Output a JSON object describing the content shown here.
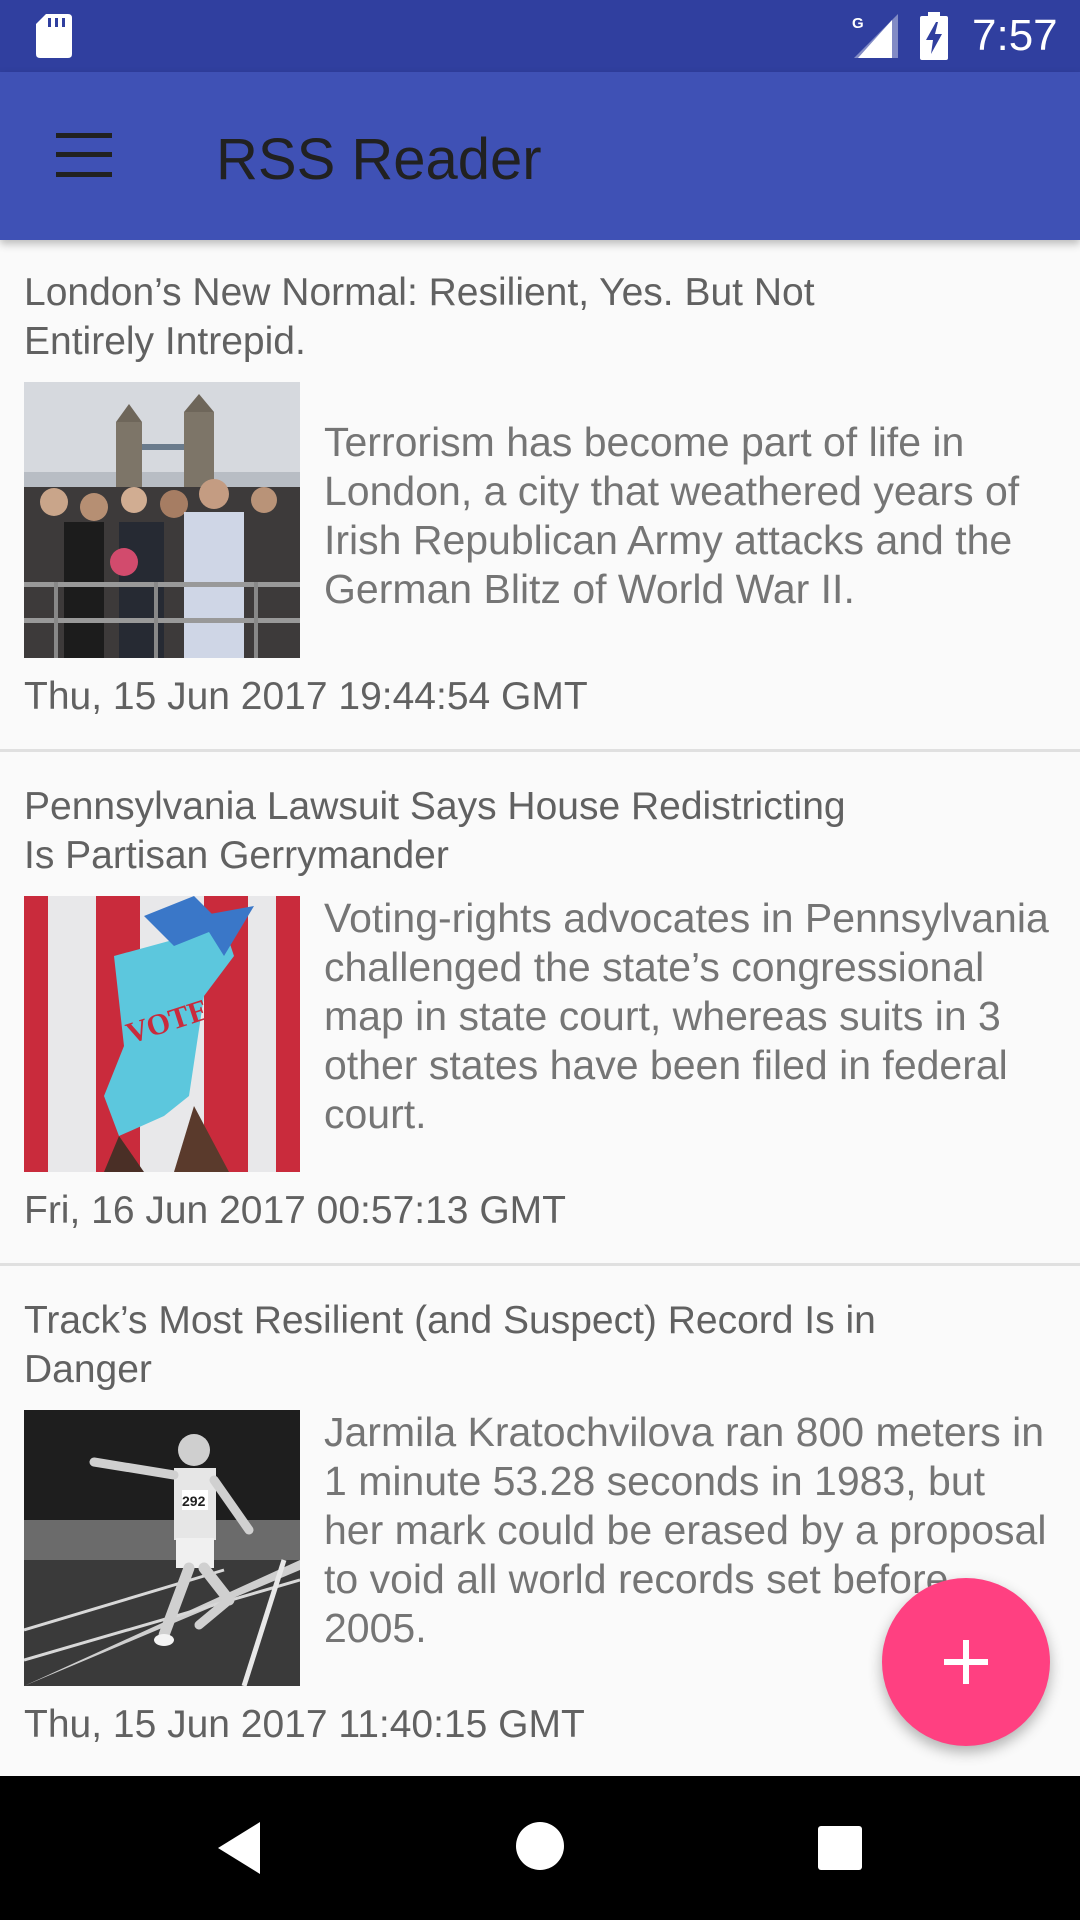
{
  "status_bar": {
    "time": "7:57",
    "network": "G",
    "icons": [
      "sd-card-icon",
      "signal-icon",
      "battery-charging-icon"
    ]
  },
  "app_bar": {
    "title": "RSS Reader",
    "menu_icon": "hamburger-menu-icon"
  },
  "articles": [
    {
      "title": "London’s New Normal: Resilient, Yes. But Not Entirely Intrepid.",
      "description": "Terrorism has become part of life in London, a city that weathered years of Irish Republican Army attacks and the German Blitz of World War II.",
      "date": "Thu, 15 Jun 2017 19:44:54 GMT"
    },
    {
      "title": "Pennsylvania Lawsuit Says House Redistricting Is Partisan Gerrymander",
      "description": "Voting-rights advocates in Pennsylvania challenged the state’s congressional map in state court, whereas suits in 3 other states have been filed in federal court.",
      "date": "Fri, 16 Jun 2017 00:57:13 GMT"
    },
    {
      "title": "Track’s Most Resilient (and Suspect) Record Is in Danger",
      "description": "Jarmila Kratochvilova ran 800 meters in 1 minute 53.28 seconds in 1983, but her mark could be erased by a proposal to void all world records set before 2005.",
      "date": "Thu, 15 Jun 2017 11:40:15 GMT"
    }
  ],
  "fab": {
    "icon": "plus-icon"
  },
  "nav_bar": {
    "icons": [
      "back-icon",
      "home-icon",
      "recents-icon"
    ]
  },
  "colors": {
    "status_bar": "#303f9f",
    "app_bar": "#3f51b5",
    "fab": "#ff4081",
    "background": "#fafafa"
  }
}
